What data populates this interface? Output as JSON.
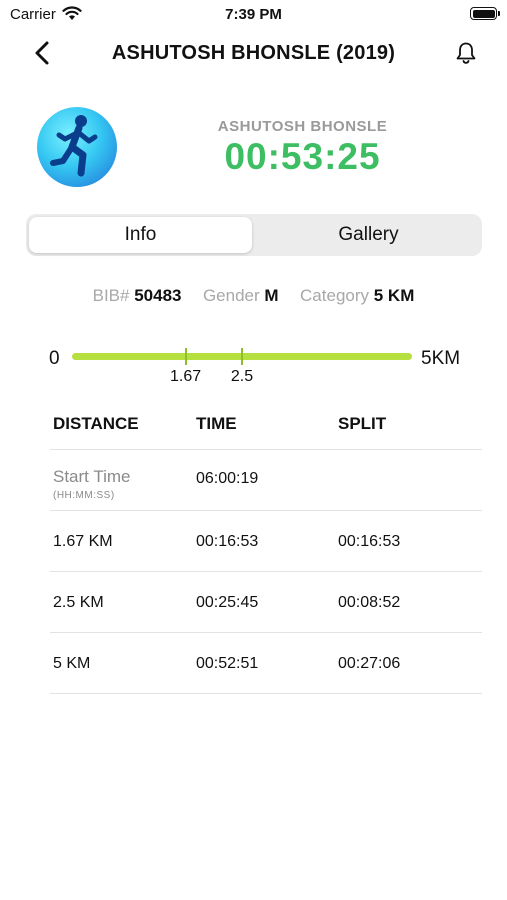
{
  "status_bar": {
    "carrier": "Carrier",
    "time": "7:39 PM"
  },
  "nav": {
    "title": "ASHUTOSH BHONSLE (2019)"
  },
  "runner": {
    "name": "ASHUTOSH BHONSLE",
    "finish_time": "00:53:25"
  },
  "tabs": [
    {
      "label": "Info",
      "selected": true
    },
    {
      "label": "Gallery",
      "selected": false
    }
  ],
  "bib": {
    "bib_label": "BIB#",
    "bib_value": "50483",
    "gender_label": "Gender",
    "gender_value": "M",
    "category_label": "Category",
    "category_value": "5 KM"
  },
  "progress": {
    "start_label": "0",
    "end_label": "5KM",
    "total_km": 5,
    "checkpoints": [
      {
        "label": "1.67",
        "km": 1.67
      },
      {
        "label": "2.5",
        "km": 2.5
      }
    ],
    "color": "#b6e03f"
  },
  "table": {
    "headers": [
      "DISTANCE",
      "TIME",
      "SPLIT"
    ],
    "start_label": "Start Time",
    "start_sub": "(HH:MM:SS)",
    "start_time": "06:00:19",
    "rows": [
      {
        "distance": "1.67 KM",
        "time": "00:16:53",
        "split": "00:16:53"
      },
      {
        "distance": "2.5 KM",
        "time": "00:25:45",
        "split": "00:08:52"
      },
      {
        "distance": "5 KM",
        "time": "00:52:51",
        "split": "00:27:06"
      }
    ]
  },
  "colors": {
    "time_green": "#3dbe62",
    "muted": "#9a9a9a"
  },
  "icons": {
    "back": "chevron-left-icon",
    "bell": "bell-icon",
    "avatar": "runner-icon",
    "wifi": "wifi-icon",
    "battery": "battery-icon"
  }
}
